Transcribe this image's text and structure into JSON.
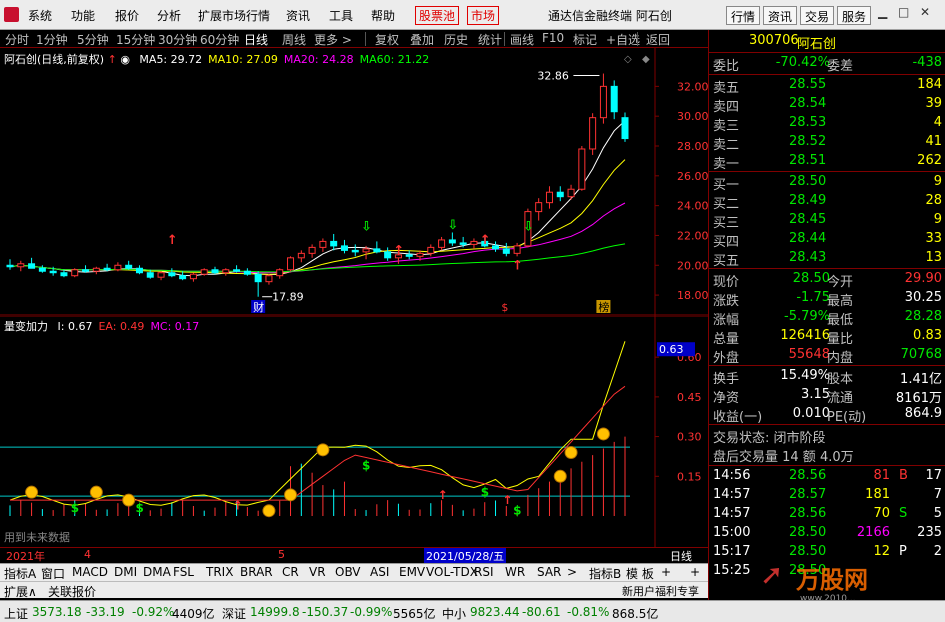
{
  "menubar": {
    "items": [
      "系统",
      "功能",
      "报价",
      "分析",
      "扩展市场行情",
      "资讯",
      "工具",
      "帮助"
    ],
    "hot_items": [
      "股票池",
      "市场"
    ],
    "title": "通达信金融终端  阿石创",
    "right_buttons": [
      "行情",
      "资讯",
      "交易",
      "服务"
    ]
  },
  "toolbar": {
    "items": [
      "分时",
      "1分钟",
      "5分钟",
      "15分钟",
      "30分钟",
      "60分钟",
      "日线",
      "周线",
      "更多 >",
      "复权",
      "叠加",
      "历史",
      "统计",
      "画线",
      "F10",
      "标记",
      "+自选",
      "返回"
    ],
    "active": "日线"
  },
  "main_chart": {
    "title": "阿石创(日线,前复权)",
    "ma": [
      {
        "label": "MA5: 29.72",
        "color": "#ffffff"
      },
      {
        "label": "MA10: 27.09",
        "color": "#ffff00"
      },
      {
        "label": "MA20: 24.28",
        "color": "#ff00ff"
      },
      {
        "label": "MA60: 21.22",
        "color": "#00ff00"
      }
    ],
    "y_ticks": [
      "32.00",
      "30.00",
      "28.00",
      "26.00",
      "24.00",
      "22.00",
      "20.00",
      "18.00"
    ],
    "high_label": "32.86",
    "low_label": "17.89",
    "markers": [
      "财",
      "$",
      "榜"
    ]
  },
  "indicator": {
    "name": "量变加力",
    "values": [
      {
        "label": "I: 0.67",
        "color": "#ffffff"
      },
      {
        "label": "EA: 0.49",
        "color": "#ff3232"
      },
      {
        "label": "MC: 0.17",
        "color": "#ff00ff"
      }
    ],
    "y_ticks": [
      "0.60",
      "0.45",
      "0.30",
      "0.15"
    ],
    "current": "0.63",
    "note": "用到未来数据"
  },
  "date_strip": {
    "labels": [
      "2021年",
      "4",
      "5"
    ],
    "cursor_date": "2021/05/28/五",
    "period": "日线"
  },
  "indicator_tabs": [
    "指标A",
    "窗口",
    "MACD",
    "DMI",
    "DMA",
    "FSL",
    "TRIX",
    "BRAR",
    "CR",
    "VR",
    "OBV",
    "ASI",
    "EMV",
    "VOL-TDX",
    "RSI",
    "WR",
    "SAR",
    ">",
    "指标B",
    "模 板",
    "+",
    "+"
  ],
  "ext_strip": {
    "left": "扩展∧",
    "mid": "关联报价",
    "right": "新用户福利专享",
    "right2": "笔",
    "right3": "深"
  },
  "quote": {
    "code": "300706",
    "name": "阿石创",
    "weibi_label": "委比",
    "weibi": "-70.42%",
    "weicha_label": "委差",
    "weicha": "-438",
    "asks": [
      {
        "label": "卖五",
        "price": "28.55",
        "vol": "184"
      },
      {
        "label": "卖四",
        "price": "28.54",
        "vol": "39"
      },
      {
        "label": "卖三",
        "price": "28.53",
        "vol": "4"
      },
      {
        "label": "卖二",
        "price": "28.52",
        "vol": "41"
      },
      {
        "label": "卖一",
        "price": "28.51",
        "vol": "262"
      }
    ],
    "bids": [
      {
        "label": "买一",
        "price": "28.50",
        "vol": "9"
      },
      {
        "label": "买二",
        "price": "28.49",
        "vol": "28"
      },
      {
        "label": "买三",
        "price": "28.45",
        "vol": "9"
      },
      {
        "label": "买四",
        "price": "28.44",
        "vol": "33"
      },
      {
        "label": "买五",
        "price": "28.43",
        "vol": "13"
      }
    ],
    "stats": [
      {
        "l1": "现价",
        "v1": "28.50",
        "c1": "grn",
        "l2": "今开",
        "v2": "29.90",
        "c2": "red"
      },
      {
        "l1": "涨跌",
        "v1": "-1.75",
        "c1": "grn",
        "l2": "最高",
        "v2": "30.25",
        "c2": "wht"
      },
      {
        "l1": "涨幅",
        "v1": "-5.79%",
        "c1": "grn",
        "l2": "最低",
        "v2": "28.28",
        "c2": "grn"
      },
      {
        "l1": "总量",
        "v1": "126416",
        "c1": "yel",
        "l2": "量比",
        "v2": "0.83",
        "c2": "yel"
      },
      {
        "l1": "外盘",
        "v1": "55648",
        "c1": "red",
        "l2": "内盘",
        "v2": "70768",
        "c2": "grn"
      }
    ],
    "stats2": [
      {
        "l1": "换手",
        "v1": "15.49%",
        "l2": "股本",
        "v2": "1.41亿"
      },
      {
        "l1": "净资",
        "v1": "3.15",
        "l2": "流通",
        "v2": "8161万"
      },
      {
        "l1": "收益(一)",
        "v1": "0.010",
        "l2": "PE(动)",
        "v2": "864.9"
      }
    ],
    "trade_status": "交易状态: 闭市阶段",
    "after_hours": "盘后交易量 14 额 4.0万",
    "ticks": [
      {
        "time": "14:56",
        "price": "28.56",
        "vol": "81",
        "vc": "red",
        "side": "B",
        "sc": "red",
        "n": "17"
      },
      {
        "time": "14:57",
        "price": "28.57",
        "vol": "181",
        "vc": "yel",
        "side": "",
        "sc": "red",
        "n": "7"
      },
      {
        "time": "14:57",
        "price": "28.56",
        "vol": "70",
        "vc": "yel",
        "side": "S",
        "sc": "grn",
        "n": "5"
      },
      {
        "time": "15:00",
        "price": "28.50",
        "vol": "2166",
        "vc": "mag",
        "side": "",
        "sc": "grn",
        "n": "235"
      },
      {
        "time": "15:17",
        "price": "28.50",
        "vol": "12",
        "vc": "yel",
        "side": "P",
        "sc": "wht",
        "n": "2"
      },
      {
        "time": "15:25",
        "price": "28.50",
        "vol": "",
        "vc": "yel",
        "side": "",
        "sc": "wht",
        "n": ""
      }
    ]
  },
  "status_bar": {
    "sh": {
      "name": "上证",
      "val": "3573.18",
      "chg": "-33.19",
      "pct": "-0.92%",
      "amt": "4409亿"
    },
    "sz": {
      "name": "深证",
      "val": "14999.8",
      "chg": "-150.37",
      "pct": "-0.99%",
      "amt": "5565亿"
    },
    "zx": {
      "name": "中小",
      "val": "9823.44",
      "chg": "-80.61",
      "pct": "-0.81%",
      "amt": "868.5亿"
    }
  },
  "watermark": {
    "logo": "万股网",
    "url": "www.2010..."
  },
  "chart_data": {
    "type": "candlestick",
    "ylim": [
      17.0,
      33.5
    ],
    "candles": [
      [
        20.0,
        20.4,
        19.7,
        19.9
      ],
      [
        19.9,
        20.3,
        19.6,
        20.1
      ],
      [
        20.1,
        20.5,
        19.8,
        19.8
      ],
      [
        19.8,
        20.0,
        19.5,
        19.6
      ],
      [
        19.6,
        19.9,
        19.3,
        19.5
      ],
      [
        19.5,
        19.7,
        19.2,
        19.3
      ],
      [
        19.3,
        19.8,
        19.2,
        19.7
      ],
      [
        19.7,
        20.0,
        19.5,
        19.6
      ],
      [
        19.6,
        19.9,
        19.4,
        19.8
      ],
      [
        19.8,
        20.1,
        19.6,
        19.7
      ],
      [
        19.7,
        20.2,
        19.6,
        20.0
      ],
      [
        20.0,
        20.3,
        19.7,
        19.8
      ],
      [
        19.8,
        20.0,
        19.4,
        19.5
      ],
      [
        19.5,
        19.7,
        19.1,
        19.2
      ],
      [
        19.2,
        19.6,
        19.0,
        19.5
      ],
      [
        19.5,
        19.8,
        19.2,
        19.3
      ],
      [
        19.3,
        19.6,
        19.0,
        19.1
      ],
      [
        19.1,
        19.5,
        18.9,
        19.4
      ],
      [
        19.4,
        19.8,
        19.3,
        19.7
      ],
      [
        19.7,
        19.9,
        19.4,
        19.5
      ],
      [
        19.5,
        19.8,
        19.3,
        19.7
      ],
      [
        19.7,
        20.0,
        19.5,
        19.6
      ],
      [
        19.6,
        19.8,
        19.3,
        19.4
      ],
      [
        19.4,
        19.6,
        17.89,
        18.9
      ],
      [
        18.9,
        19.4,
        18.7,
        19.3
      ],
      [
        19.3,
        19.8,
        19.1,
        19.7
      ],
      [
        19.7,
        20.6,
        19.6,
        20.5
      ],
      [
        20.5,
        21.0,
        20.2,
        20.8
      ],
      [
        20.8,
        21.4,
        20.5,
        21.2
      ],
      [
        21.2,
        21.8,
        20.9,
        21.6
      ],
      [
        21.6,
        22.1,
        21.0,
        21.3
      ],
      [
        21.3,
        21.7,
        20.8,
        21.0
      ],
      [
        21.0,
        21.4,
        20.6,
        20.9
      ],
      [
        20.9,
        21.3,
        20.4,
        21.1
      ],
      [
        21.1,
        21.6,
        20.8,
        20.9
      ],
      [
        20.9,
        21.2,
        20.3,
        20.5
      ],
      [
        20.5,
        20.9,
        20.1,
        20.7
      ],
      [
        20.7,
        21.0,
        20.4,
        20.6
      ],
      [
        20.6,
        21.0,
        20.3,
        20.8
      ],
      [
        20.8,
        21.4,
        20.6,
        21.2
      ],
      [
        21.2,
        21.9,
        21.0,
        21.7
      ],
      [
        21.7,
        22.2,
        21.3,
        21.5
      ],
      [
        21.5,
        21.9,
        21.2,
        21.4
      ],
      [
        21.4,
        21.8,
        21.1,
        21.6
      ],
      [
        21.6,
        21.9,
        21.2,
        21.3
      ],
      [
        21.3,
        21.6,
        20.9,
        21.1
      ],
      [
        21.1,
        21.5,
        20.6,
        20.8
      ],
      [
        20.8,
        21.5,
        20.6,
        21.3
      ],
      [
        21.3,
        23.8,
        21.2,
        23.6
      ],
      [
        23.6,
        24.5,
        23.0,
        24.2
      ],
      [
        24.2,
        25.3,
        23.8,
        24.9
      ],
      [
        24.9,
        25.3,
        24.3,
        24.6
      ],
      [
        24.6,
        25.4,
        24.4,
        25.1
      ],
      [
        25.1,
        28.0,
        25.0,
        27.8
      ],
      [
        27.8,
        30.2,
        27.4,
        29.9
      ],
      [
        29.9,
        32.86,
        29.5,
        32.0
      ],
      [
        32.0,
        32.4,
        29.8,
        30.3
      ],
      [
        29.9,
        30.25,
        28.28,
        28.5
      ]
    ]
  }
}
